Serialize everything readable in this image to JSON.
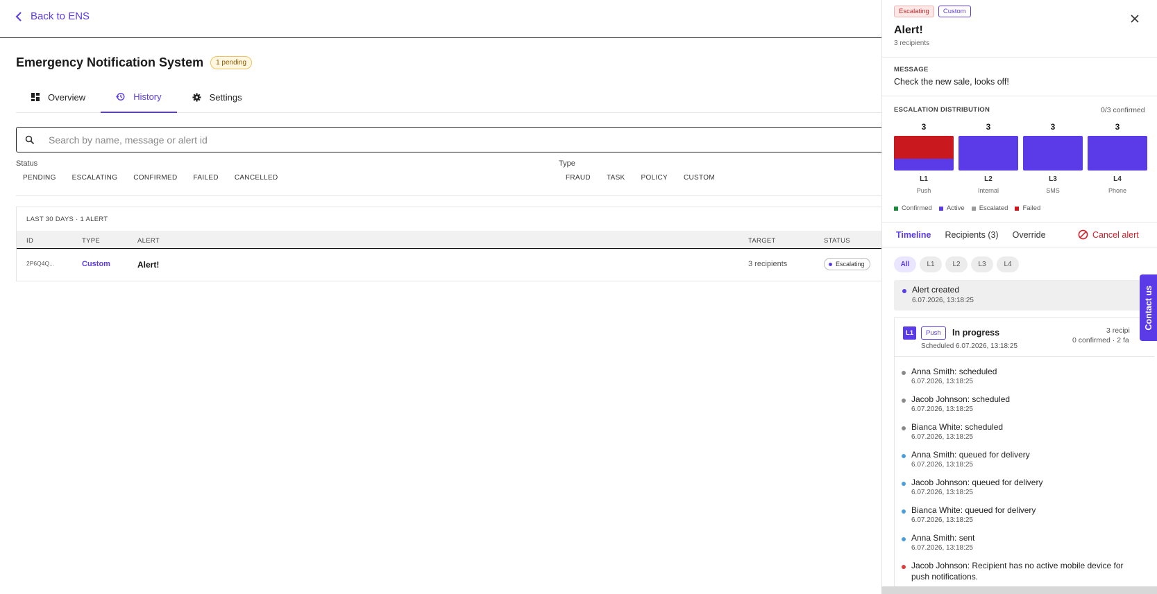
{
  "nav": {
    "back_label": "Back to ENS"
  },
  "page": {
    "title": "Emergency Notification System",
    "pending_badge": "1 pending"
  },
  "tabs": [
    {
      "label": "Overview",
      "icon": "dashboard-icon"
    },
    {
      "label": "History",
      "icon": "history-icon"
    },
    {
      "label": "Settings",
      "icon": "gear-icon"
    }
  ],
  "search": {
    "placeholder": "Search by name, message or alert id"
  },
  "filters": {
    "status_label": "Status",
    "status": [
      "PENDING",
      "ESCALATING",
      "CONFIRMED",
      "FAILED",
      "CANCELLED"
    ],
    "type_label": "Type",
    "type": [
      "FRAUD",
      "TASK",
      "POLICY",
      "CUSTOM"
    ]
  },
  "table": {
    "summary": "LAST 30 DAYS · 1 ALERT",
    "columns": [
      "ID",
      "TYPE",
      "ALERT",
      "TARGET",
      "STATUS"
    ],
    "rows": [
      {
        "id": "2P6Q4Q...",
        "type": "Custom",
        "alert": "Alert!",
        "target": "3 recipients",
        "status": "Escalating"
      }
    ]
  },
  "panel": {
    "badges": {
      "status": "Escalating",
      "type": "Custom"
    },
    "title": "Alert!",
    "subtitle": "3 recipients",
    "message_label": "MESSAGE",
    "message": "Check the new sale, looks off!",
    "distribution_label": "ESCALATION DISTRIBUTION",
    "confirmed": "0/3 confirmed",
    "levels": [
      {
        "count": "3",
        "level": "L1",
        "channel": "Push",
        "failed_fraction": 0.66
      },
      {
        "count": "3",
        "level": "L2",
        "channel": "Internal",
        "failed_fraction": 0
      },
      {
        "count": "3",
        "level": "L3",
        "channel": "SMS",
        "failed_fraction": 0
      },
      {
        "count": "3",
        "level": "L4",
        "channel": "Phone",
        "failed_fraction": 0
      }
    ],
    "legend": [
      {
        "label": "Confirmed",
        "color": "#1a8a3a"
      },
      {
        "label": "Active",
        "color": "#5b3be8"
      },
      {
        "label": "Escalated",
        "color": "#9a9a9a"
      },
      {
        "label": "Failed",
        "color": "#c9191e"
      }
    ],
    "tabs": [
      "Timeline",
      "Recipients (3)",
      "Override"
    ],
    "cancel_label": "Cancel alert",
    "level_filters": [
      "All",
      "L1",
      "L2",
      "L3",
      "L4"
    ],
    "created": {
      "title": "Alert created",
      "time": "6.07.2026, 13:18:25"
    },
    "level_card": {
      "level": "L1",
      "channel": "Push",
      "state": "In progress",
      "scheduled": "Scheduled 6.07.2026, 13:18:25",
      "recipients": "3 recipi",
      "summary": "0 confirmed · 2 fa"
    },
    "events": [
      {
        "text": "Anna Smith: scheduled",
        "time": "6.07.2026, 13:18:25",
        "color": "#8a8a8a"
      },
      {
        "text": "Jacob Johnson: scheduled",
        "time": "6.07.2026, 13:18:25",
        "color": "#8a8a8a"
      },
      {
        "text": "Bianca White: scheduled",
        "time": "6.07.2026, 13:18:25",
        "color": "#8a8a8a"
      },
      {
        "text": "Anna Smith: queued for delivery",
        "time": "6.07.2026, 13:18:25",
        "color": "#4a9fe0"
      },
      {
        "text": "Jacob Johnson: queued for delivery",
        "time": "6.07.2026, 13:18:25",
        "color": "#4a9fe0"
      },
      {
        "text": "Bianca White: queued for delivery",
        "time": "6.07.2026, 13:18:25",
        "color": "#4a9fe0"
      },
      {
        "text": "Anna Smith: sent",
        "time": "6.07.2026, 13:18:25",
        "color": "#4a9fe0"
      },
      {
        "text": "Jacob Johnson: Recipient has no active mobile device for",
        "text2": "push notifications.",
        "color": "#e03a3a"
      }
    ]
  },
  "contact": {
    "label": "Contact us"
  }
}
